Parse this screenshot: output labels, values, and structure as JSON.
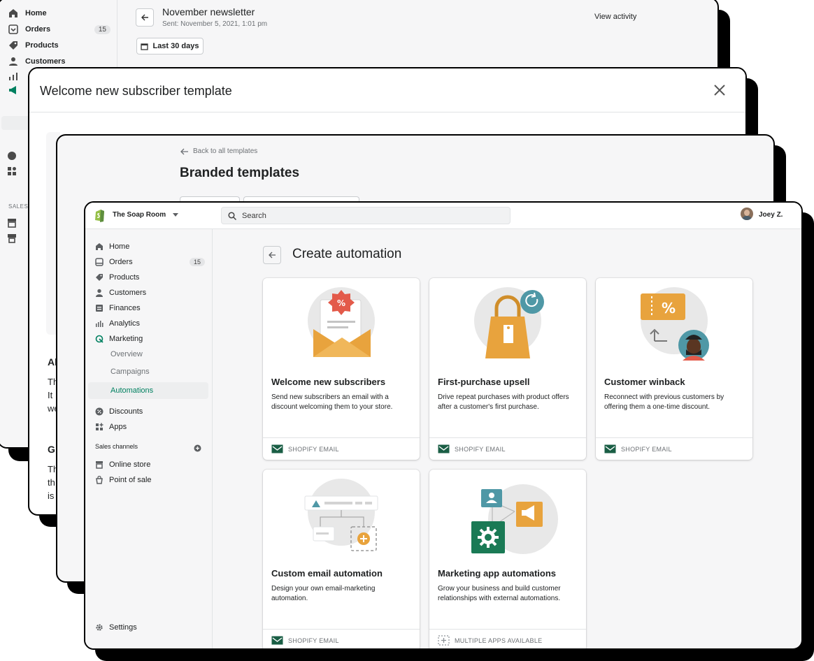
{
  "window1": {
    "nav": [
      {
        "label": "Home",
        "icon": "home-icon"
      },
      {
        "label": "Orders",
        "icon": "orders-icon",
        "badge": "15"
      },
      {
        "label": "Products",
        "icon": "tag-icon"
      },
      {
        "label": "Customers",
        "icon": "person-icon"
      }
    ],
    "sales_label": "SALES",
    "title": "November newsletter",
    "subtitle": "Sent: November 5, 2021, 1:01 pm",
    "view_activity": "View activity",
    "date_range": "Last 30 days"
  },
  "window2": {
    "title": "Welcome new subscriber template",
    "fragments": [
      "Al",
      "Th",
      "It",
      "we",
      "G",
      "Th",
      "th",
      "is"
    ]
  },
  "window3": {
    "back_link": "Back to all templates",
    "title": "Branded templates"
  },
  "app": {
    "store_name": "The Soap Room",
    "search_placeholder": "Search",
    "user_name": "Joey Z.",
    "nav": {
      "home": "Home",
      "orders": "Orders",
      "orders_badge": "15",
      "products": "Products",
      "customers": "Customers",
      "finances": "Finances",
      "analytics": "Analytics",
      "marketing": "Marketing",
      "overview": "Overview",
      "campaigns": "Campaigns",
      "automations": "Automations",
      "discounts": "Discounts",
      "apps": "Apps",
      "sales_channels": "Sales channels",
      "online_store": "Online store",
      "point_of_sale": "Point of sale",
      "settings": "Settings"
    },
    "page_title": "Create automation",
    "cards": [
      {
        "title": "Welcome new subscribers",
        "desc": "Send new subscribers an email with a discount welcoming them to your store.",
        "footer": "SHOPIFY EMAIL"
      },
      {
        "title": "First-purchase upsell",
        "desc": "Drive repeat purchases with product offers after a customer's first purchase.",
        "footer": "SHOPIFY EMAIL"
      },
      {
        "title": "Customer winback",
        "desc": "Reconnect with previous customers by offering them a one-time discount.",
        "footer": "SHOPIFY EMAIL"
      },
      {
        "title": "Custom email automation",
        "desc": "Design your own email-marketing automation.",
        "footer": "SHOPIFY EMAIL"
      },
      {
        "title": "Marketing app automations",
        "desc": "Grow your business and build customer relationships with external automations.",
        "footer": "MULTIPLE APPS AVAILABLE"
      }
    ],
    "colors": {
      "brand_green": "#008060",
      "accent_orange": "#e8a33d",
      "dark_green": "#1a5e45",
      "teal": "#4f98a6"
    }
  }
}
